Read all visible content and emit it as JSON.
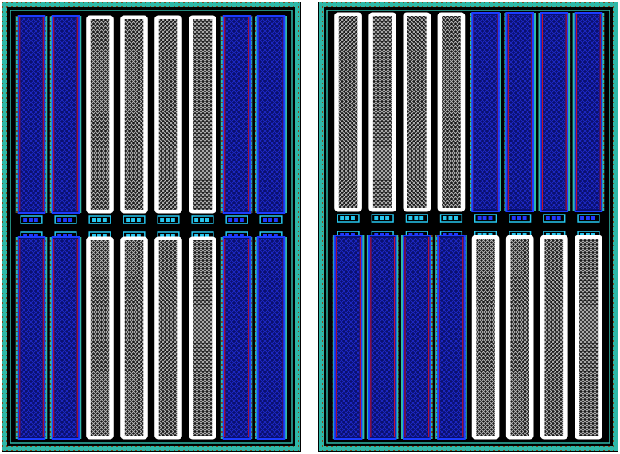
{
  "colors": {
    "background": "#000000",
    "page": "#ffffff",
    "guard_ring": "#2fb8a8",
    "guard_ring_dots": "#8a5a2a",
    "blue_fill": "#0a1070",
    "blue_hatch": "#1f2bd0",
    "blue_border": "#1c3cff",
    "red_line": "#c8102e",
    "white_finger": "#ffffff",
    "white_hatch": "#8a8a8a",
    "contact_cyan": "#27c8f0",
    "contact_blue": "#2038ff"
  },
  "cells": [
    {
      "top_row": [
        "blue",
        "blue",
        "white",
        "white",
        "white",
        "white",
        "blue",
        "blue"
      ],
      "bottom_row": [
        "blue",
        "blue",
        "white",
        "white",
        "white",
        "white",
        "blue",
        "blue"
      ]
    },
    {
      "top_row": [
        "white",
        "white",
        "white",
        "white",
        "blue",
        "blue",
        "blue",
        "blue"
      ],
      "bottom_row": [
        "blue",
        "blue",
        "blue",
        "blue",
        "white",
        "white",
        "white",
        "white"
      ]
    }
  ]
}
